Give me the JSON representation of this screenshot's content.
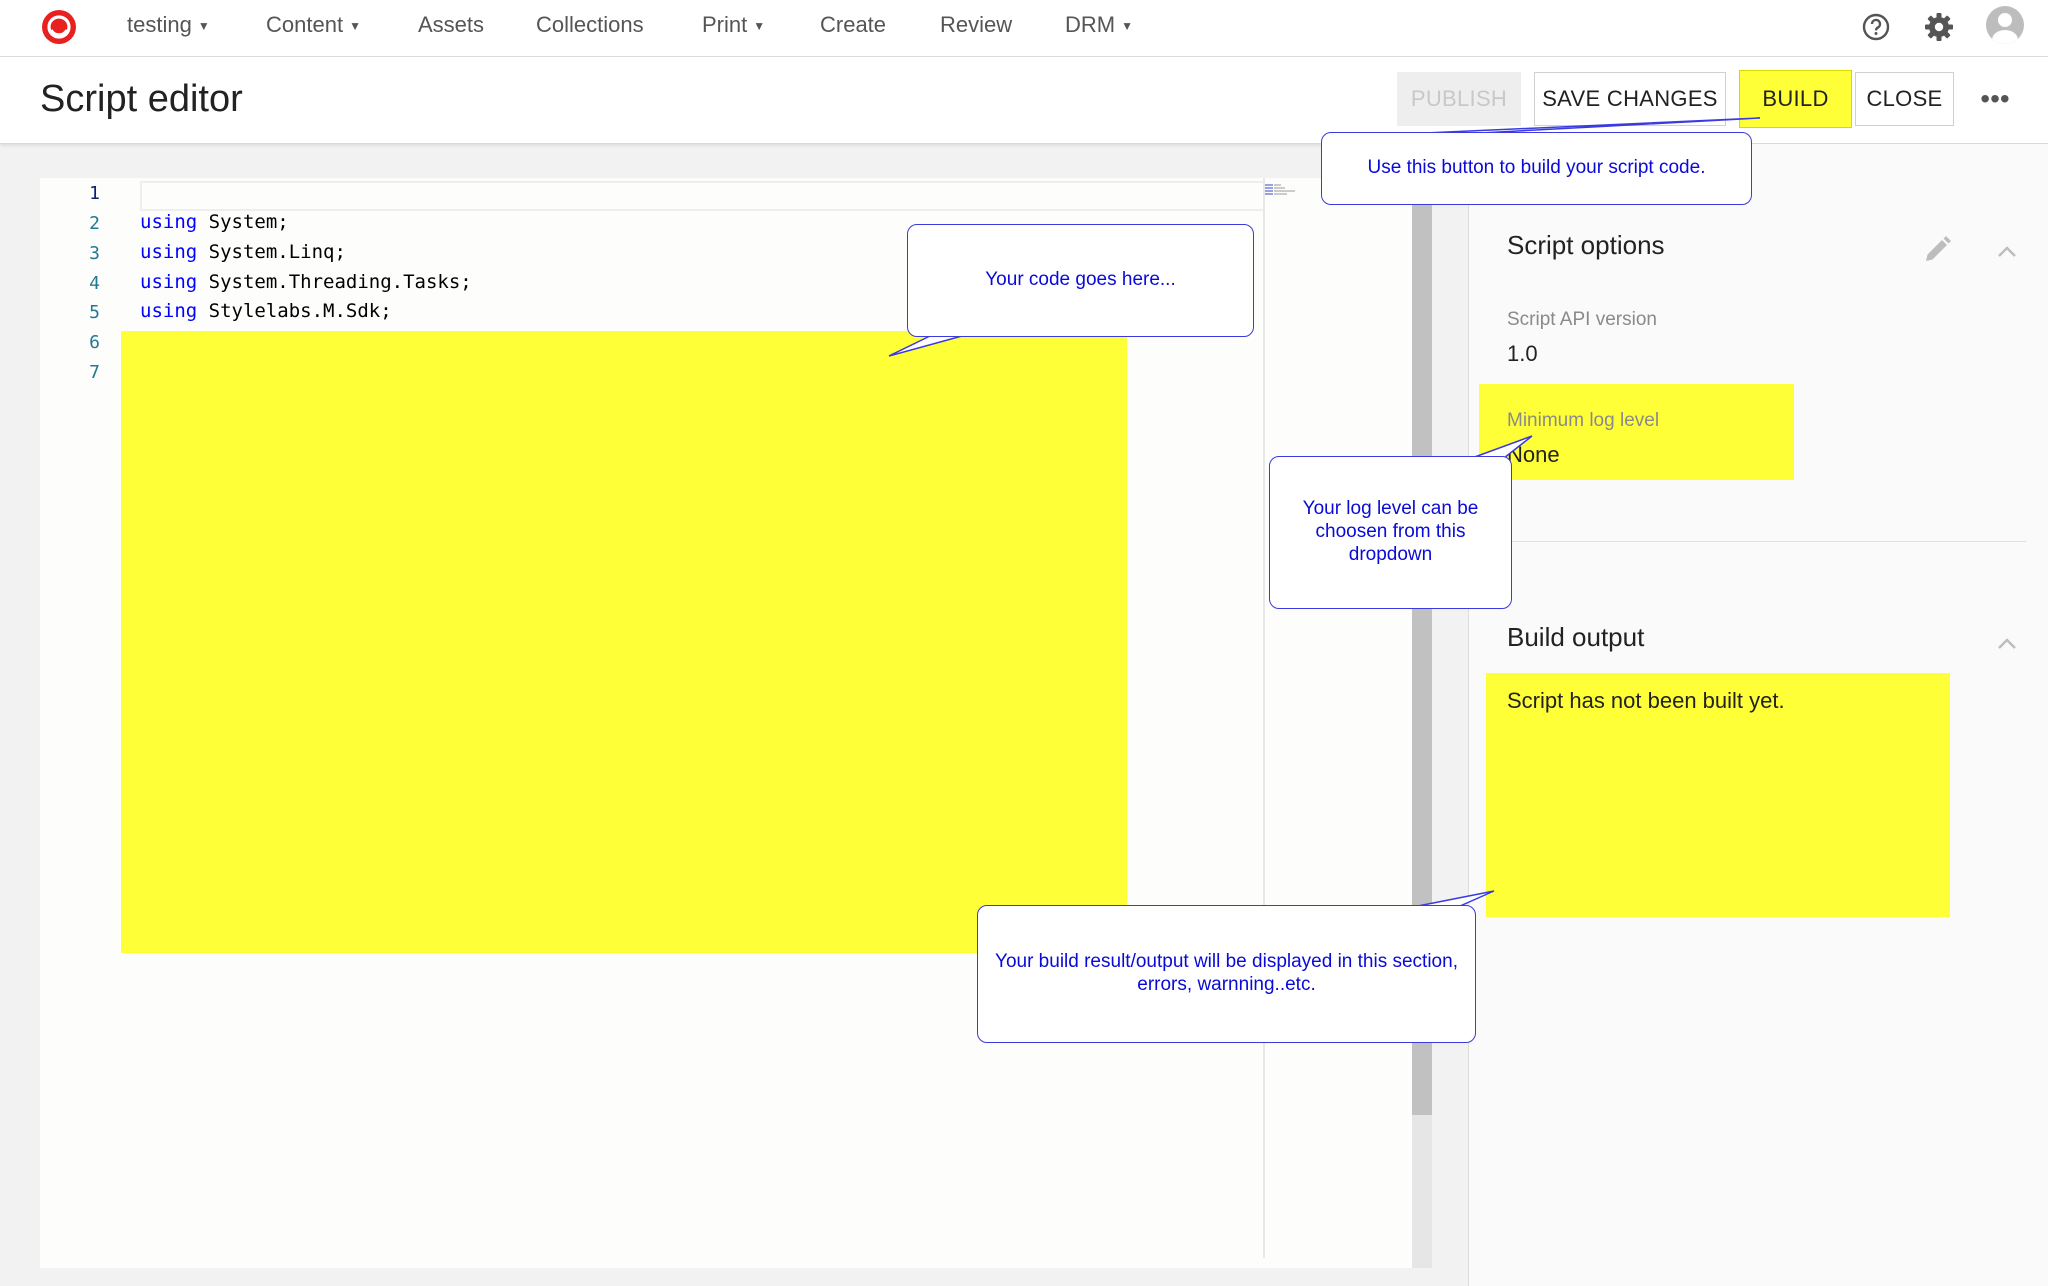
{
  "colors": {
    "highlight": "#ffff38",
    "callout_text": "#0a0ad8",
    "callout_border": "#3a3ae0",
    "keyword": "#0000ff",
    "line_number": "#237893",
    "brand": "#e8201f"
  },
  "nav": {
    "logo_icon": "sitecore-logo-icon",
    "items": [
      {
        "label": "testing",
        "has_dropdown": true
      },
      {
        "label": "Content",
        "has_dropdown": true
      },
      {
        "label": "Assets",
        "has_dropdown": false
      },
      {
        "label": "Collections",
        "has_dropdown": false
      },
      {
        "label": "Print",
        "has_dropdown": true
      },
      {
        "label": "Create",
        "has_dropdown": false
      },
      {
        "label": "Review",
        "has_dropdown": false
      },
      {
        "label": "DRM",
        "has_dropdown": true
      }
    ],
    "icons": [
      "help-icon",
      "gear-icon",
      "avatar-icon"
    ]
  },
  "header": {
    "title": "Script editor",
    "buttons": {
      "publish": "PUBLISH",
      "save": "SAVE CHANGES",
      "build": "BUILD",
      "close": "CLOSE",
      "more": "•••"
    }
  },
  "editor": {
    "line_numbers": [
      "1",
      "2",
      "3",
      "4",
      "5",
      "6",
      "7"
    ],
    "lines": [
      {
        "keyword": "",
        "text": ""
      },
      {
        "keyword": "using",
        "text": " System;"
      },
      {
        "keyword": "using",
        "text": " System.Linq;"
      },
      {
        "keyword": "using",
        "text": " System.Threading.Tasks;"
      },
      {
        "keyword": "using",
        "text": " Stylelabs.M.Sdk;"
      },
      {
        "keyword": "",
        "text": ""
      },
      {
        "keyword": "",
        "text": ""
      }
    ]
  },
  "script_options": {
    "title": "Script options",
    "api_version_label": "Script API version",
    "api_version_value": "1.0",
    "log_level_label": "Minimum log level",
    "log_level_value": "None"
  },
  "build_output": {
    "title": "Build output",
    "message": "Script has not been built yet."
  },
  "callouts": {
    "build": "Use this button to build your script code.",
    "code": "Your code goes here...",
    "log_level": "Your log level can be choosen from this dropdown",
    "output": "Your build result/output will be displayed in this section, errors, warnning..etc."
  }
}
